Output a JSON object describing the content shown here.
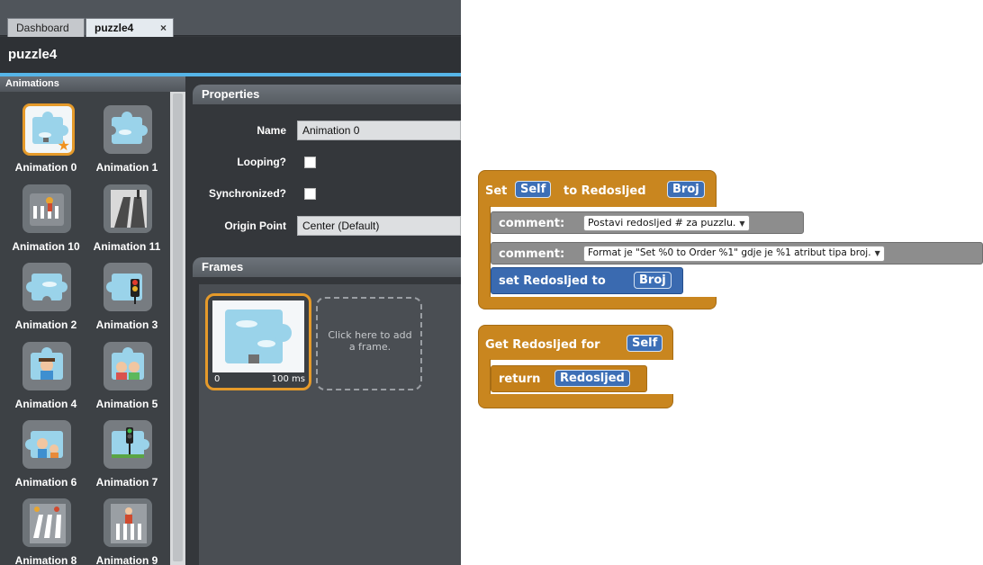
{
  "tabs": [
    {
      "label": "Dashboard"
    },
    {
      "label": "puzzle4",
      "close": "×"
    }
  ],
  "document_title": "puzzle4",
  "animations_panel": {
    "header": "Animations",
    "items": [
      {
        "label": "Animation 0"
      },
      {
        "label": "Animation 1"
      },
      {
        "label": "Animation 10"
      },
      {
        "label": "Animation 11"
      },
      {
        "label": "Animation 2"
      },
      {
        "label": "Animation 3"
      },
      {
        "label": "Animation 4"
      },
      {
        "label": "Animation 5"
      },
      {
        "label": "Animation 6"
      },
      {
        "label": "Animation 7"
      },
      {
        "label": "Animation 8"
      },
      {
        "label": "Animation 9"
      }
    ]
  },
  "properties": {
    "header": "Properties",
    "name_label": "Name",
    "name_value": "Animation 0",
    "looping_label": "Looping?",
    "synchronized_label": "Synchronized?",
    "origin_label": "Origin Point",
    "origin_value": "Center (Default)"
  },
  "frames": {
    "header": "Frames",
    "frame_index": "0",
    "frame_duration": "100 ms",
    "add_frame_text": "Click here to add a frame."
  },
  "blocks": {
    "setter": {
      "set_word": "Set",
      "target": "Self",
      "to_word": "to Redosljed",
      "param": "Broj",
      "comment1_label": "comment:",
      "comment1_value": "Postavi redosljed # za puzzlu.",
      "comment2_label": "comment:",
      "comment2_value": "Format je \"Set %0 to Order %1\" gdje je %1 atribut tipa broj.",
      "inner_text": "set Redosljed to",
      "inner_param": "Broj"
    },
    "getter": {
      "get_text": "Get Redosljed for",
      "target": "Self",
      "return_word": "return",
      "return_value": "Redosljed"
    }
  },
  "colors": {
    "accent_orange": "#e59a2a",
    "block_orange": "#c9861f",
    "block_blue": "#3d6fb6",
    "block_gray": "#8d8d8d",
    "editor_bg": "#34373b"
  }
}
